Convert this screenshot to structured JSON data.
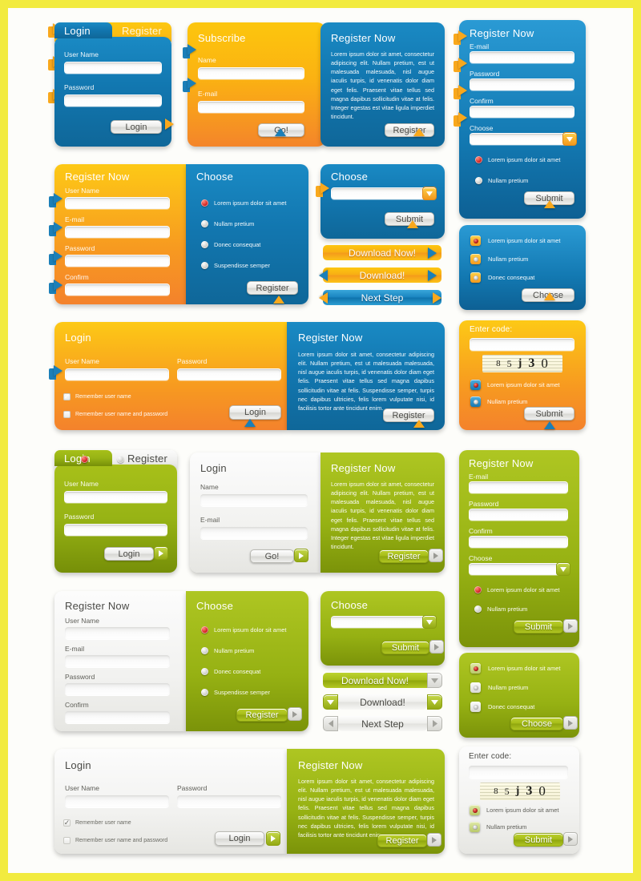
{
  "kit": {
    "lorem_short": "Lorem ipsum dolor sit amet",
    "lorem_blue_1": "Lorem ipsum dolor sit amet, consectetur adipiscing elit. Nullam pretium, est ut malesuada malesuada, nisl augue iaculis turpis, id venenatis dolor diam eget felis. Praesent vitae tellus sed magna dapibus sollicitudin vitae at felis. Integer egestas est vitae ligula imperdiet tincidunt.",
    "lorem_long": "Lorem ipsum dolor sit amet, consectetur adipiscing elit. Nullam pretium, est ut malesuada malesuada, nisl augue iaculis turpis, id venenatis dolor diam eget felis. Praesent vitae tellus sed magna dapibus sollicitudin vitae at felis. Suspendisse semper, turpis nec dapibus ultricies, felis lorem vulputate nisi, id facilisis tortor ante tincidunt enim."
  },
  "labels": {
    "login": "Login",
    "register": "Register",
    "register_now": "Register Now",
    "subscribe": "Subscribe",
    "choose": "Choose",
    "user_name": "User Name",
    "password": "Password",
    "confirm": "Confirm",
    "email": "E-mail",
    "name": "Name",
    "go": "Go!",
    "submit": "Submit",
    "download_now": "Download Now!",
    "download": "Download!",
    "next_step": "Next Step",
    "enter_code": "Enter code:",
    "remember_user": "Remember user name",
    "remember_both": "Remember user name and password"
  },
  "list_items": [
    "Lorem ipsum dolor sit amet",
    "Nullam pretium",
    "Donec consequat",
    "Suspendisse semper"
  ],
  "captcha": {
    "digits": [
      "8",
      "5",
      "j",
      "3",
      "0"
    ]
  },
  "colors": {
    "blue": "#1277b0",
    "orange": "#f8ae14",
    "yellow": "#fdc60f",
    "green": "#a5bb18",
    "grey": "#f0f0ee",
    "page_border": "#f2eb3f",
    "radio_on": "#c01c1c"
  },
  "fields": {
    "value": "",
    "placeholder": ""
  }
}
